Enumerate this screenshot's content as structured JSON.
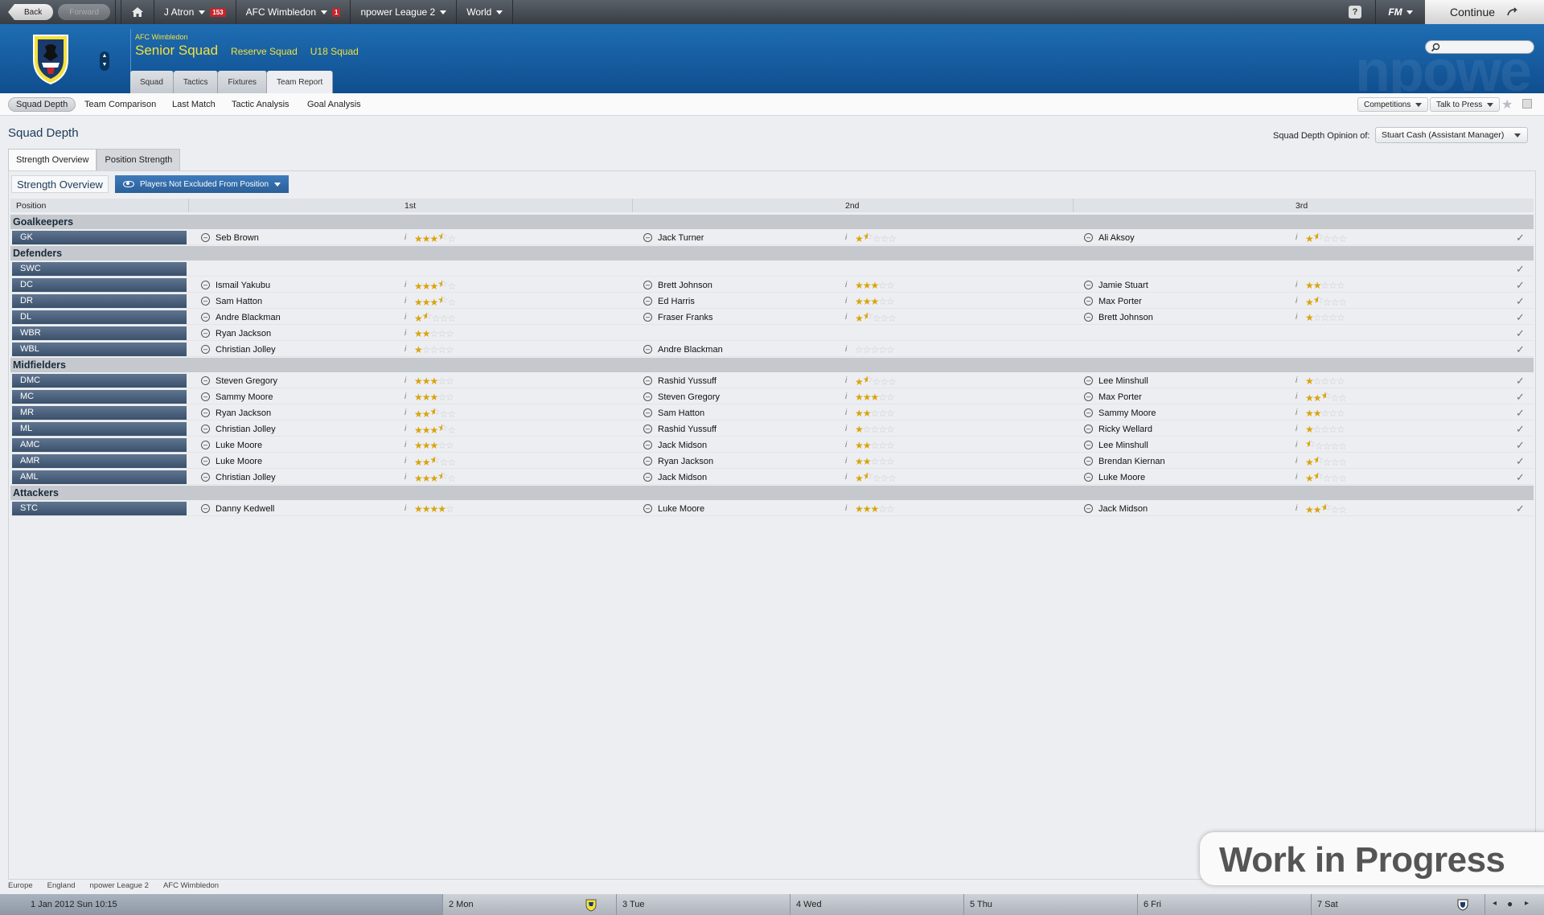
{
  "topbar": {
    "back": "Back",
    "forward": "Forward",
    "manager": "J Atron",
    "inbox_count": "153",
    "club": "AFC Wimbledon",
    "news_count": "1",
    "league": "npower League 2",
    "world": "World",
    "help": "?",
    "fm_menu": "FM",
    "continue": "Continue"
  },
  "header": {
    "club_name": "AFC Wimbledon",
    "squad_main": "Senior Squad",
    "squad_links": [
      "Reserve Squad",
      "U18 Squad"
    ],
    "tabs": [
      "Squad",
      "Tactics",
      "Fixtures",
      "Team Report"
    ],
    "active_tab": "Team Report",
    "watermark": "npowe"
  },
  "subtabs": {
    "items": [
      "Squad Depth",
      "Team Comparison",
      "Last Match",
      "Tactic Analysis",
      "Goal Analysis"
    ],
    "competitions": "Competitions",
    "talk_to_press": "Talk to Press"
  },
  "page": {
    "title": "Squad Depth",
    "opinion_label": "Squad Depth Opinion of:",
    "opinion_value": "Stuart Cash (Assistant Manager)",
    "view_tabs": [
      "Strength Overview",
      "Position Strength"
    ],
    "panel_title": "Strength Overview",
    "filter": "Players Not Excluded From Position"
  },
  "table": {
    "headers": {
      "position": "Position",
      "first": "1st",
      "second": "2nd",
      "third": "3rd"
    },
    "groups": [
      {
        "name": "Goalkeepers",
        "rows": [
          {
            "pos": "GK",
            "p": [
              [
                "Seb Brown",
                3.5
              ],
              [
                "Jack Turner",
                1.5
              ],
              [
                "Ali Aksoy",
                1.5
              ]
            ]
          }
        ]
      },
      {
        "name": "Defenders",
        "rows": [
          {
            "pos": "SWC",
            "p": []
          },
          {
            "pos": "DC",
            "p": [
              [
                "Ismail Yakubu",
                3.5
              ],
              [
                "Brett Johnson",
                3
              ],
              [
                "Jamie Stuart",
                2
              ]
            ]
          },
          {
            "pos": "DR",
            "p": [
              [
                "Sam Hatton",
                3.5
              ],
              [
                "Ed Harris",
                3
              ],
              [
                "Max Porter",
                1.5
              ]
            ]
          },
          {
            "pos": "DL",
            "p": [
              [
                "Andre Blackman",
                1.5
              ],
              [
                "Fraser Franks",
                1.5
              ],
              [
                "Brett Johnson",
                1
              ]
            ]
          },
          {
            "pos": "WBR",
            "p": [
              [
                "Ryan Jackson",
                2
              ]
            ]
          },
          {
            "pos": "WBL",
            "p": [
              [
                "Christian Jolley",
                1
              ],
              [
                "Andre Blackman",
                0
              ]
            ]
          }
        ]
      },
      {
        "name": "Midfielders",
        "rows": [
          {
            "pos": "DMC",
            "p": [
              [
                "Steven Gregory",
                3
              ],
              [
                "Rashid Yussuff",
                1.5
              ],
              [
                "Lee Minshull",
                1
              ]
            ]
          },
          {
            "pos": "MC",
            "p": [
              [
                "Sammy Moore",
                3
              ],
              [
                "Steven Gregory",
                3
              ],
              [
                "Max Porter",
                2.5
              ]
            ]
          },
          {
            "pos": "MR",
            "p": [
              [
                "Ryan Jackson",
                2.5
              ],
              [
                "Sam Hatton",
                2
              ],
              [
                "Sammy Moore",
                2
              ]
            ]
          },
          {
            "pos": "ML",
            "p": [
              [
                "Christian Jolley",
                3.5
              ],
              [
                "Rashid Yussuff",
                1
              ],
              [
                "Ricky Wellard",
                1
              ]
            ]
          },
          {
            "pos": "AMC",
            "p": [
              [
                "Luke Moore",
                3
              ],
              [
                "Jack Midson",
                2
              ],
              [
                "Lee Minshull",
                0.5
              ]
            ]
          },
          {
            "pos": "AMR",
            "p": [
              [
                "Luke Moore",
                2.5
              ],
              [
                "Ryan Jackson",
                2
              ],
              [
                "Brendan Kiernan",
                1.5
              ]
            ]
          },
          {
            "pos": "AML",
            "p": [
              [
                "Christian Jolley",
                3.5
              ],
              [
                "Jack Midson",
                1.5
              ],
              [
                "Luke Moore",
                1.5
              ]
            ]
          }
        ]
      },
      {
        "name": "Attackers",
        "rows": [
          {
            "pos": "STC",
            "p": [
              [
                "Danny Kedwell",
                4
              ],
              [
                "Luke Moore",
                3
              ],
              [
                "Jack Midson",
                2.5
              ]
            ]
          }
        ]
      }
    ]
  },
  "breadcrumb": [
    "Europe",
    "England",
    "npower League 2",
    "AFC Wimbledon"
  ],
  "calendar": {
    "today": "1 Jan 2012  Sun 10:15",
    "days": [
      "2 Mon",
      "3 Tue",
      "4 Wed",
      "5 Thu",
      "6 Fri",
      "7 Sat"
    ]
  },
  "overlay": "Work in Progress",
  "colors": {
    "brand": "#1a64ac",
    "accent": "#f3e13a",
    "star": "#d9a40b",
    "position_chip": "#4a6079"
  }
}
